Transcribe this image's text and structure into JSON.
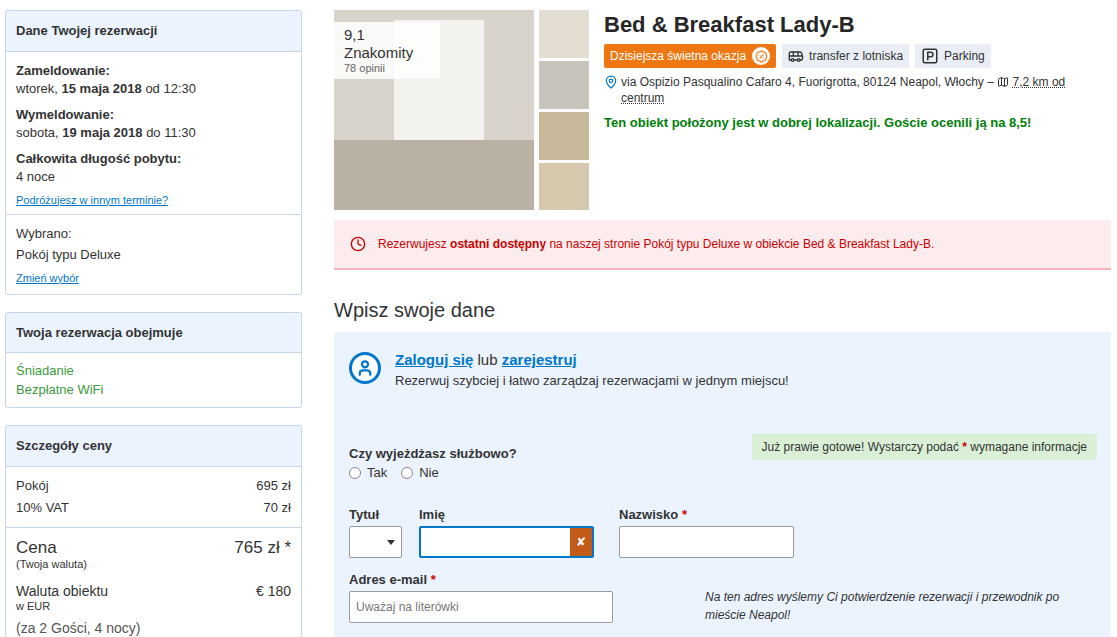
{
  "sidebar": {
    "booking": {
      "title": "Dane Twojej rezerwacji",
      "checkin": {
        "label": "Zameldowanie:",
        "prefix": "wtorek,",
        "date": "15 maja 2018",
        "suffix": "od 12:30"
      },
      "checkout": {
        "label": "Wymeldowanie:",
        "prefix": "sobota,",
        "date": "19 maja 2018",
        "suffix": "do 11:30"
      },
      "length": {
        "label": "Całkowita długość pobytu:",
        "value": "4 noce"
      },
      "change_dates": "Podróżujesz w innym terminie?",
      "selected_label": "Wybrano:",
      "selected_value": "Pokój typu Deluxe",
      "change_selection": "Zmień wybór"
    },
    "includes": {
      "title": "Twoja rezerwacja obejmuje",
      "items": [
        "Śniadanie",
        "Bezpłatne WiFi"
      ]
    },
    "price": {
      "title": "Szczegóły ceny",
      "lines": [
        {
          "label": "Pokój",
          "value": "695 zł"
        },
        {
          "label": "10% VAT",
          "value": "70 zł"
        }
      ],
      "total": {
        "label": "Cena",
        "note": "(Twoja waluta)",
        "value": "765 zł *"
      },
      "property_currency": {
        "label": "Waluta obiektu",
        "note": "w EUR",
        "value": "€ 180"
      },
      "guests": "(za 2 Gości, 4 nocy)"
    }
  },
  "hotel": {
    "rating": {
      "score": "9,1 Znakomity",
      "reviews": "78 opinii"
    },
    "name": "Bed & Breakfast Lady-B",
    "badges": [
      {
        "label": "Dzisiejsza świetna okazja",
        "kind": "deal"
      },
      {
        "label": "transfer z lotniska",
        "kind": "transfer"
      },
      {
        "label": "Parking",
        "kind": "parking"
      }
    ],
    "address": "via Ospizio Pasqualino Cafaro 4, Fuorigrotta, 80124 Neapol, Włochy –",
    "distance": "7,2 km od centrum",
    "location_note": "Ten obiekt położony jest w dobrej lokalizacji. Goście ocenili ją na 8,5!"
  },
  "alert": {
    "before": "Rezerwujesz",
    "emphasis": "ostatni dostępny",
    "after": "na naszej stronie Pokój typu Deluxe w obiekcie Bed & Breakfast Lady-B."
  },
  "form": {
    "heading": "Wpisz swoje dane",
    "login": {
      "login_link": "Zaloguj się",
      "or": "lub",
      "register_link": "zarejestruj",
      "subtitle": "Rezerwuj szybciej i łatwo zarządzaj rezerwacjami w jednym miejscu!"
    },
    "business_trip": {
      "question": "Czy wyjeżdżasz służbowo?",
      "options": [
        {
          "label": "Tak",
          "selected": false
        },
        {
          "label": "Nie",
          "selected": false
        }
      ]
    },
    "note": {
      "before": "Już prawie gotowe! Wystarczy podać",
      "mark": "*",
      "after": "wymagane informacje"
    },
    "required_mark": "*",
    "fields": [
      {
        "label": "Tytuł",
        "kind": "select",
        "required": false,
        "focused": false,
        "value": ""
      },
      {
        "label": "Imię",
        "kind": "text",
        "required": false,
        "focused": true,
        "value": "",
        "clear_icon": "✘"
      },
      {
        "label": "Nazwisko",
        "kind": "text",
        "required": true,
        "focused": false,
        "value": ""
      }
    ],
    "email": {
      "label": "Adres e-mail",
      "required": true,
      "placeholder": "Uważaj na literówki",
      "hint": "Na ten adres wyślemy Ci potwierdzenie rezerwacji i przewodnik po mieście Neapol!"
    }
  }
}
